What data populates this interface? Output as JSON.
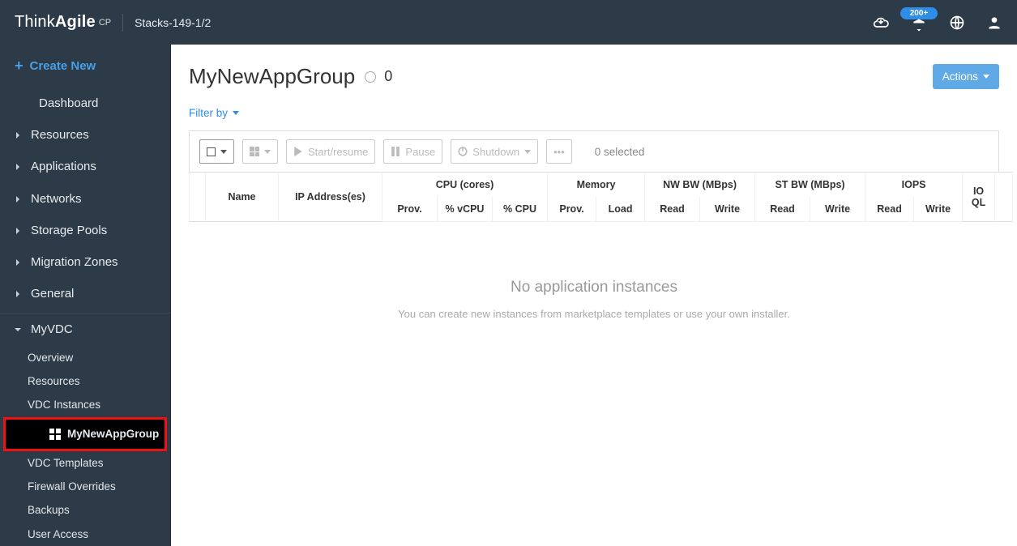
{
  "header": {
    "brand_thin": "Think",
    "brand_bold": "Agile",
    "brand_suffix": "CP",
    "stack_label": "Stacks-149-1/2",
    "notif_badge": "200+"
  },
  "sidebar": {
    "create_label": "Create New",
    "items": [
      {
        "label": "Dashboard",
        "caret": "none"
      },
      {
        "label": "Resources",
        "caret": "right"
      },
      {
        "label": "Applications",
        "caret": "right"
      },
      {
        "label": "Networks",
        "caret": "right"
      },
      {
        "label": "Storage Pools",
        "caret": "right"
      },
      {
        "label": "Migration Zones",
        "caret": "right"
      },
      {
        "label": "General",
        "caret": "right"
      }
    ],
    "vdc_label": "MyVDC",
    "vdc_items": [
      "Overview",
      "Resources",
      "VDC Instances"
    ],
    "vdc_app_group": "MyNewAppGroup",
    "vdc_items_after": [
      "VDC Templates",
      "Firewall Overrides",
      "Backups",
      "User Access"
    ]
  },
  "page": {
    "title": "MyNewAppGroup",
    "count": "0",
    "actions_label": "Actions",
    "filter_label": "Filter by",
    "toolbar": {
      "start": "Start/resume",
      "pause": "Pause",
      "shutdown": "Shutdown",
      "selected": "0 selected",
      "more": "•••"
    },
    "table": {
      "groups": {
        "name": "Name",
        "ip": "IP Address(es)",
        "cpu": "CPU (cores)",
        "memory": "Memory",
        "nwbw": "NW BW (MBps)",
        "stbw": "ST BW (MBps)",
        "iops": "IOPS",
        "ioql": "IO QL"
      },
      "cols": {
        "prov": "Prov.",
        "vcpu": "% vCPU",
        "pcpu": "% CPU",
        "mprov": "Prov.",
        "mload": "Load",
        "nread": "Read",
        "nwrite": "Write",
        "sread": "Read",
        "swrite": "Write",
        "iread": "Read",
        "iwrite": "Write"
      }
    },
    "empty_title": "No application instances",
    "empty_sub": "You can create new instances from marketplace templates or use your own installer."
  }
}
